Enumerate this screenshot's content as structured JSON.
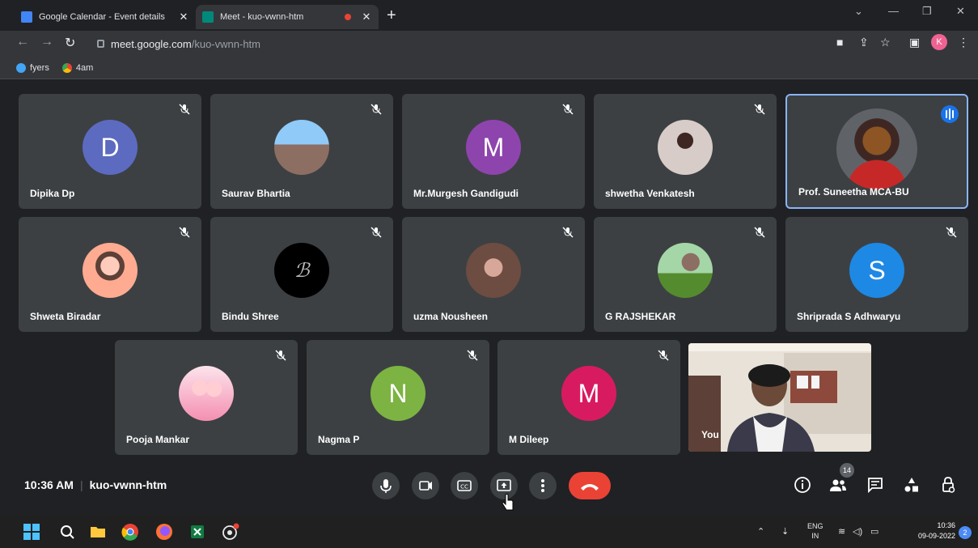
{
  "browser": {
    "tabs": [
      {
        "title": "Google Calendar - Event details",
        "active": false
      },
      {
        "title": "Meet - kuo-vwnn-htm",
        "active": true
      }
    ],
    "new_tab": "+",
    "url_host": "meet.google.com",
    "url_path": "/kuo-vwnn-htm",
    "profile_initial": "K",
    "bookmarks": [
      "fyers",
      "4am"
    ]
  },
  "meet": {
    "participants": [
      {
        "name": "Dipika Dp",
        "initial": "D",
        "color": "#5c6bc0"
      },
      {
        "name": "Saurav Bhartia",
        "initial": "",
        "color": "#8d6e63"
      },
      {
        "name": "Mr.Murgesh Gandigudi",
        "initial": "M",
        "color": "#8e44ad"
      },
      {
        "name": "shwetha Venkatesh",
        "initial": "",
        "color": "#bdbdbd"
      },
      {
        "name": "Prof. Suneetha MCA-BU",
        "initial": "",
        "color": "#c62828"
      },
      {
        "name": "Shweta Biradar",
        "initial": "",
        "color": "#ffab91"
      },
      {
        "name": "Bindu Shree",
        "initial": "",
        "color": "#000000"
      },
      {
        "name": "uzma Nousheen",
        "initial": "",
        "color": "#a1887f"
      },
      {
        "name": "G RAJSHEKAR",
        "initial": "",
        "color": "#7cb342"
      },
      {
        "name": "Shripradа S Adhwaryu",
        "initial": "S",
        "color": "#1e88e5"
      },
      {
        "name": "Pooja Mankar",
        "initial": "",
        "color": "#f8bbd0"
      },
      {
        "name": "Nagma P",
        "initial": "N",
        "color": "#7cb342"
      },
      {
        "name": "M Dileep",
        "initial": "M",
        "color": "#d81b60"
      }
    ],
    "self_label": "You",
    "time": "10:36 AM",
    "meeting_code": "kuo-vwnn-htm",
    "people_count": "14"
  },
  "taskbar": {
    "lang_line1": "ENG",
    "lang_line2": "IN",
    "clock_time": "10:36",
    "clock_date": "09-09-2022",
    "notifications": "2"
  }
}
